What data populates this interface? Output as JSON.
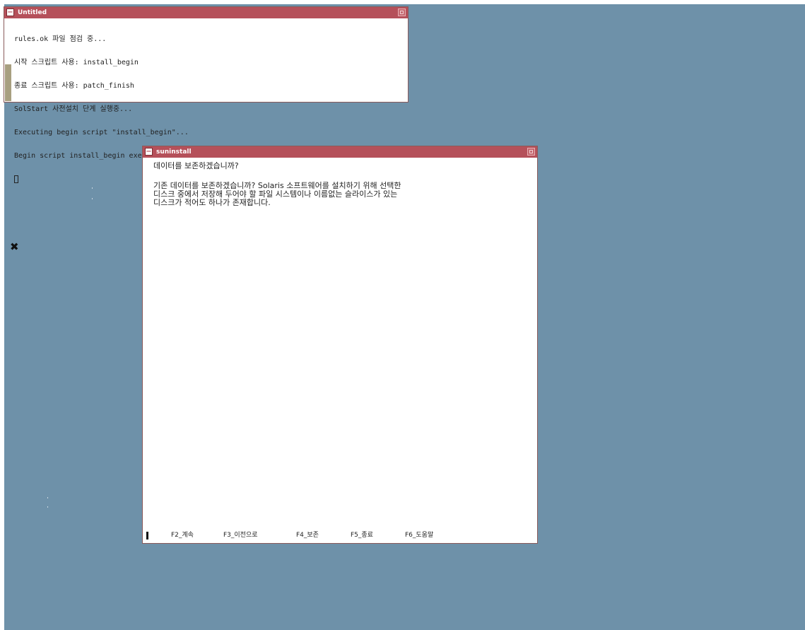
{
  "desktop": {
    "background_color": "#6e91a9",
    "pointer_glyph": "✖"
  },
  "terminal_window": {
    "title": "Untitled",
    "title_color": "#b5505a",
    "lines": [
      "rules.ok 파일 점검 중...",
      "시작 스크립트 사용: install_begin",
      "종료 스크립트 사용: patch_finish",
      "SolStart 사전설치 단계 실행중...",
      "Executing begin script \"install_begin\"...",
      "Begin script install_begin execution completed."
    ]
  },
  "suninstall_window": {
    "title": "suninstall",
    "heading": "데이터를 보존하겠습니까?",
    "paragraph_lines": [
      "기존 데이터를 보존하겠습니까? Solaris 소프트웨어를 설치하기 위해 선택한",
      "디스크 중에서 저장해 두어야 할 파일 시스템이나 이름없는 슬라이스가 있는",
      "디스크가 적어도 하나가 존재합니다."
    ],
    "function_keys": [
      "F2_계속",
      "F3_이전으로",
      "F4_보존",
      "F5_종료",
      "F6_도움말"
    ]
  }
}
